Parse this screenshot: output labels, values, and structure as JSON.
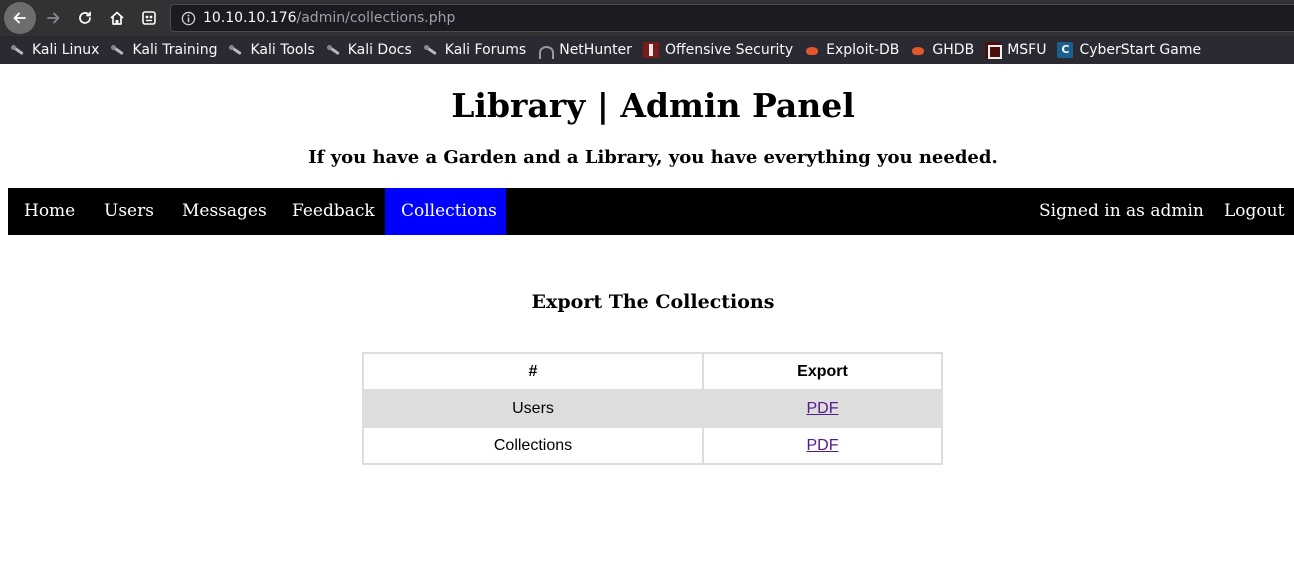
{
  "browser": {
    "url_host": "10.10.10.176",
    "url_path": "/admin/collections.php",
    "bookmarks": [
      {
        "label": "Kali Linux",
        "icon": "kali-dragon-icon"
      },
      {
        "label": "Kali Training",
        "icon": "kali-dragon-icon"
      },
      {
        "label": "Kali Tools",
        "icon": "kali-dragon-icon"
      },
      {
        "label": "Kali Docs",
        "icon": "kali-dragon-icon"
      },
      {
        "label": "Kali Forums",
        "icon": "kali-dragon-icon"
      },
      {
        "label": "NetHunter",
        "icon": "nethunter-icon"
      },
      {
        "label": "Offensive Security",
        "icon": "offsec-icon"
      },
      {
        "label": "Exploit-DB",
        "icon": "exploitdb-icon"
      },
      {
        "label": "GHDB",
        "icon": "exploitdb-icon"
      },
      {
        "label": "MSFU",
        "icon": "msfu-icon"
      },
      {
        "label": "CyberStart Game",
        "icon": "cyberstart-icon"
      }
    ]
  },
  "header": {
    "title": "Library | Admin Panel",
    "subtitle": "If you have a Garden and a Library, you have everything you needed."
  },
  "nav": {
    "items": [
      {
        "label": "Home"
      },
      {
        "label": "Users"
      },
      {
        "label": "Messages"
      },
      {
        "label": "Feedback"
      },
      {
        "label": "Collections",
        "active": true
      }
    ],
    "signed_in": "Signed in as admin",
    "logout": "Logout"
  },
  "main": {
    "heading": "Export The Collections",
    "table": {
      "headers": [
        "#",
        "Export"
      ],
      "rows": [
        {
          "name": "Users",
          "export": "PDF"
        },
        {
          "name": "Collections",
          "export": "PDF"
        }
      ]
    }
  },
  "colors": {
    "navbar_bg": "#000000",
    "nav_active_bg": "#0000ff",
    "table_border": "#dddddd",
    "link": "#551a8b"
  }
}
